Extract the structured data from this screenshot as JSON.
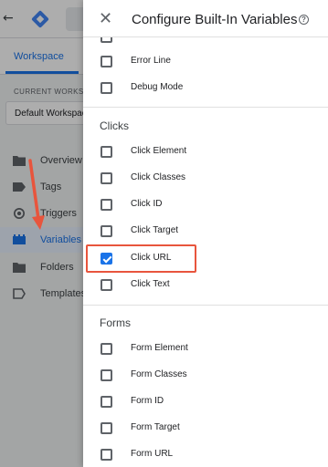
{
  "app": {
    "tabs": {
      "workspace": "Workspace"
    },
    "current_workspace_label": "CURRENT WORKSPACE",
    "workspace_select_value": "Default Workspace",
    "nav": [
      {
        "label": "Overview",
        "icon": "folder-icon"
      },
      {
        "label": "Tags",
        "icon": "tag-icon"
      },
      {
        "label": "Triggers",
        "icon": "trigger-icon"
      },
      {
        "label": "Variables",
        "icon": "variables-icon",
        "active": true
      },
      {
        "label": "Folders",
        "icon": "folder-icon"
      },
      {
        "label": "Templates",
        "icon": "template-icon"
      }
    ]
  },
  "drawer": {
    "title": "Configure Built-In Variables",
    "help_glyph": "?",
    "close_glyph": "✕",
    "top_items": [
      {
        "label": "Error Line",
        "checked": false
      },
      {
        "label": "Debug Mode",
        "checked": false
      }
    ],
    "sections": [
      {
        "title": "Clicks",
        "items": [
          {
            "label": "Click Element",
            "checked": false
          },
          {
            "label": "Click Classes",
            "checked": false
          },
          {
            "label": "Click ID",
            "checked": false
          },
          {
            "label": "Click Target",
            "checked": false
          },
          {
            "label": "Click URL",
            "checked": true
          },
          {
            "label": "Click Text",
            "checked": false
          }
        ]
      },
      {
        "title": "Forms",
        "items": [
          {
            "label": "Form Element",
            "checked": false
          },
          {
            "label": "Form Classes",
            "checked": false
          },
          {
            "label": "Form ID",
            "checked": false
          },
          {
            "label": "Form Target",
            "checked": false
          },
          {
            "label": "Form URL",
            "checked": false
          }
        ]
      }
    ]
  },
  "colors": {
    "accent": "#1a73e8",
    "highlight": "#e8553d"
  }
}
